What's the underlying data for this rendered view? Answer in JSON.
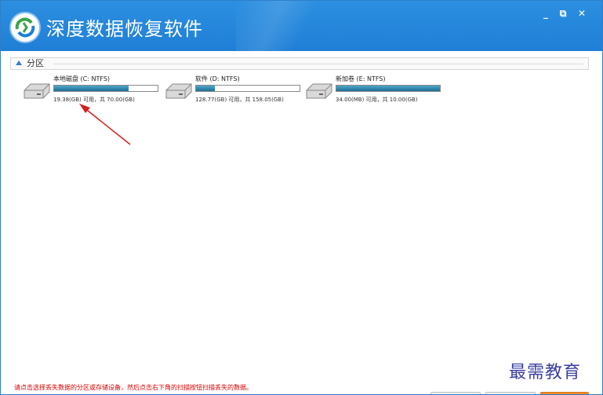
{
  "app": {
    "title": "深度数据恢复软件",
    "window_controls": [
      "_",
      "⧉",
      "✕"
    ]
  },
  "section": {
    "label": "分区"
  },
  "drives": [
    {
      "name": "本地磁盘 (C: NTFS)",
      "info": "19.38(GB) 可用，共 70.00(GB)",
      "free_fraction": 0.72
    },
    {
      "name": "软件 (D: NTFS)",
      "info": "128.77(GB) 可用，共 158.05(GB)",
      "free_fraction": 0.18
    },
    {
      "name": "新加卷 (E: NTFS)",
      "info": "34.00(MB) 可用，共 10.00(GB)",
      "free_fraction": 1.0
    }
  ],
  "status": {
    "hint": "请点击选择丢失数据的分区或存储设备，然后点击右下角的扫描按钮扫描丢失的数据。"
  },
  "watermark": "最需教育",
  "colors": {
    "titlebar": "#1f7fd6",
    "bar_fill": "#1c6f95",
    "hint_text": "#d40000",
    "annotation_arrow": "#d42020"
  }
}
